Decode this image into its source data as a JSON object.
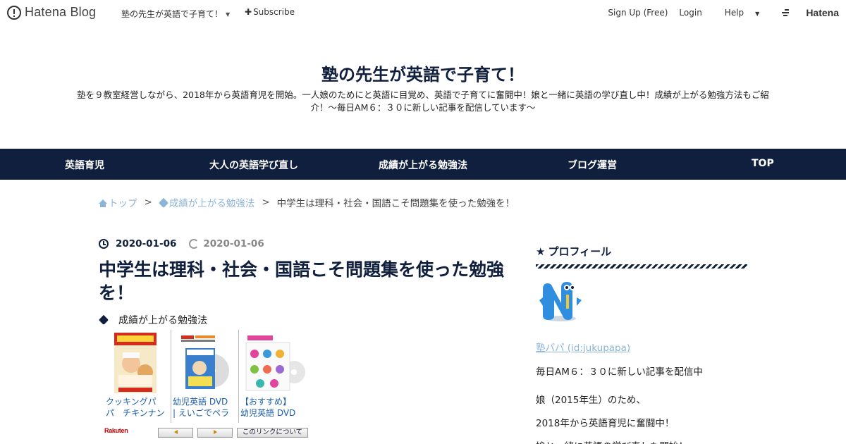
{
  "topbar": {
    "brand": "Hatena Blog",
    "blog_switch": "塾の先生が英語で子育て！",
    "subscribe": "Subscribe",
    "signup": "Sign Up (Free)",
    "login": "Login",
    "help": "Help",
    "hatena": "Hatena"
  },
  "header": {
    "title": "塾の先生が英語で子育て！",
    "description": "塾を９教室経営しながら、2018年から英語育児を開始。一人娘のためにと英語に目覚め、英語で子育てに奮闘中！娘と一緒に英語の学び直し中！成績が上がる勉強方法もご紹介！～毎日AM６：３０に新しい記事を配信しています～"
  },
  "nav": {
    "items": [
      {
        "label": "英語育児"
      },
      {
        "label": "大人の英語学び直し"
      },
      {
        "label": "成績が上がる勉強法"
      },
      {
        "label": "ブログ運営"
      },
      {
        "label": "TOP"
      }
    ]
  },
  "breadcrumb": {
    "home": "トップ",
    "category": "成績が上がる勉強法",
    "current": "中学生は理科・社会・国語こそ問題集を使った勉強を！",
    "separator": ">"
  },
  "article": {
    "published": "2020-01-06",
    "updated": "2020-01-06",
    "title": "中学生は理科・社会・国語こそ問題集を使った勉強を！",
    "category": "成績が上がる勉強法"
  },
  "widget": {
    "items": [
      {
        "line1": "クッキングパ",
        "line2": "パ　チキンナン"
      },
      {
        "line1": "幼児英語 DVD",
        "line2": "| えいごでペラ"
      },
      {
        "line1": "【おすすめ】",
        "line2": "幼児英語 DVD"
      }
    ],
    "rakuten": "Rakuten",
    "about_link": "このリンクについて"
  },
  "sidebar": {
    "heading": "プロフィール",
    "profile_name": "塾パパ (id:jukupapa)",
    "lines": [
      "毎日AM６：３０に新しい記事を配信中",
      "娘（2015年生）のため、",
      "2018年から英語育児に奮闘中！",
      "娘と一緒に英語の学び直しも開始！"
    ]
  },
  "colors": {
    "navy": "#0f1f3d",
    "link": "#8cb5d8"
  }
}
